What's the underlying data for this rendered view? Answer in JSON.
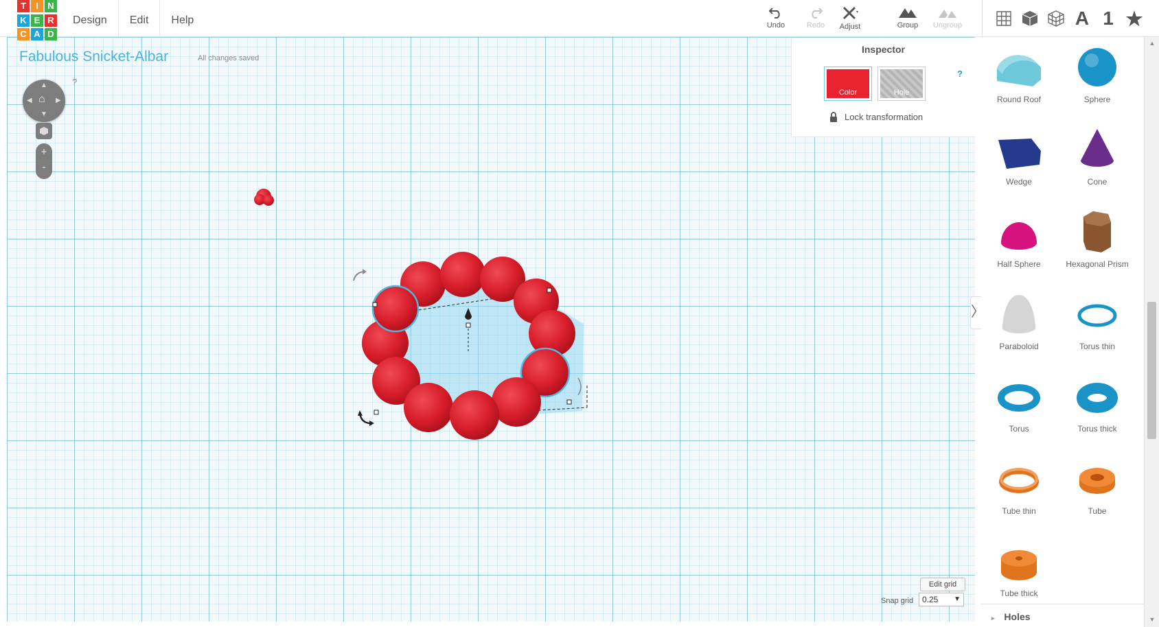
{
  "logo": {
    "letters": [
      "T",
      "I",
      "N",
      "K",
      "E",
      "R",
      "C",
      "A",
      "D"
    ],
    "colors": [
      "#e8312c",
      "#f29524",
      "#3bb54a",
      "#1ea4dd",
      "#3bb54a",
      "#e8312c",
      "#f29524",
      "#1ea4dd",
      "#3bb54a"
    ]
  },
  "menu": {
    "items": [
      {
        "label": "Design"
      },
      {
        "label": "Edit"
      },
      {
        "label": "Help"
      }
    ]
  },
  "toolbar": {
    "undo_label": "Undo",
    "redo_label": "Redo",
    "adjust_label": "Adjust",
    "group_label": "Group",
    "ungroup_label": "Ungroup"
  },
  "view_tools": {
    "icons": [
      "grid-view-icon",
      "box-view-icon",
      "wireframe-view-icon",
      "text-tool-icon",
      "number-tool-icon",
      "star-tool-icon"
    ],
    "text_letter": "A",
    "number_char": "1",
    "star_char": "★"
  },
  "design": {
    "title": "Fabulous Snicket-Albar",
    "save_status": "All changes saved"
  },
  "navigation": {
    "help": "?",
    "zoom_in": "+",
    "zoom_out": "-"
  },
  "inspector": {
    "title": "Inspector",
    "help": "?",
    "color_label": "Color",
    "color_value": "#e8232f",
    "hole_label": "Hole",
    "lock_label": "Lock transformation"
  },
  "grid": {
    "edit_label": "Edit grid",
    "snap_label": "Snap grid",
    "snap_value": "0.25",
    "snap_arrow": "▼"
  },
  "panel": {
    "toggle": "〉",
    "shapes": [
      {
        "label": "Round Roof",
        "icon": "round-roof-icon",
        "color": "#6ec8dc"
      },
      {
        "label": "Sphere",
        "icon": "sphere-icon",
        "color": "#1a93c9"
      },
      {
        "label": "Wedge",
        "icon": "wedge-icon",
        "color": "#253a8c"
      },
      {
        "label": "Cone",
        "icon": "cone-icon",
        "color": "#6a2d8c"
      },
      {
        "label": "Half Sphere",
        "icon": "half-sphere-icon",
        "color": "#d6127f"
      },
      {
        "label": "Hexagonal Prism",
        "icon": "hexagonal-prism-icon",
        "color": "#8b5530"
      },
      {
        "label": "Paraboloid",
        "icon": "paraboloid-icon",
        "color": "#d5d5d5"
      },
      {
        "label": "Torus thin",
        "icon": "torus-thin-icon",
        "color": "#1a93c9"
      },
      {
        "label": "Torus",
        "icon": "torus-icon",
        "color": "#1a93c9"
      },
      {
        "label": "Torus thick",
        "icon": "torus-thick-icon",
        "color": "#1a93c9"
      },
      {
        "label": "Tube thin",
        "icon": "tube-thin-icon",
        "color": "#e0741c"
      },
      {
        "label": "Tube",
        "icon": "tube-icon",
        "color": "#e0741c"
      },
      {
        "label": "Tube thick",
        "icon": "tube-thick-icon",
        "color": "#e0741c"
      }
    ],
    "holes_label": "Holes",
    "holes_arrow": "▸"
  },
  "scrollbar": {
    "up": "▲",
    "down": "▼"
  }
}
